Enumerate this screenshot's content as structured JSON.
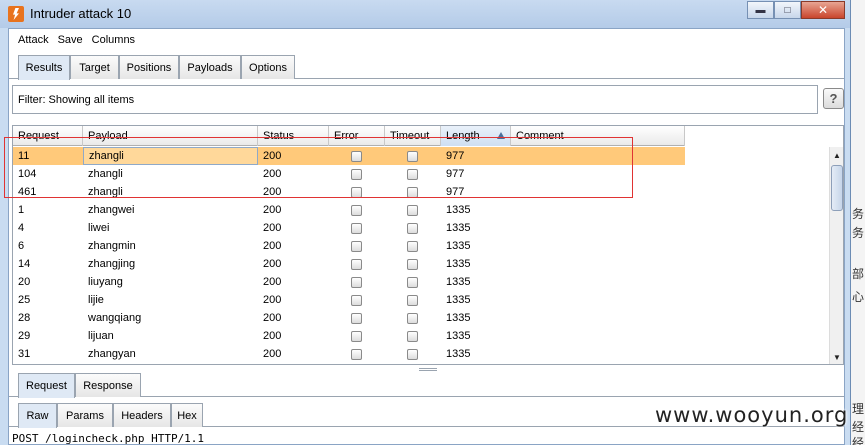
{
  "window": {
    "title": "Intruder attack 10"
  },
  "menu": [
    "Attack",
    "Save",
    "Columns"
  ],
  "tabs": [
    "Results",
    "Target",
    "Positions",
    "Payloads",
    "Options"
  ],
  "filter": {
    "text": "Filter:  Showing all items",
    "help_label": "?"
  },
  "table": {
    "columns": [
      "Request",
      "Payload",
      "Status",
      "Error",
      "Timeout",
      "Length",
      "Comment"
    ],
    "rows": [
      {
        "request": "11",
        "payload": "zhangli",
        "status": "200",
        "length": "977"
      },
      {
        "request": "104",
        "payload": "zhangli",
        "status": "200",
        "length": "977"
      },
      {
        "request": "461",
        "payload": "zhangli",
        "status": "200",
        "length": "977"
      },
      {
        "request": "1",
        "payload": "zhangwei",
        "status": "200",
        "length": "1335"
      },
      {
        "request": "4",
        "payload": "liwei",
        "status": "200",
        "length": "1335"
      },
      {
        "request": "6",
        "payload": "zhangmin",
        "status": "200",
        "length": "1335"
      },
      {
        "request": "14",
        "payload": "zhangjing",
        "status": "200",
        "length": "1335"
      },
      {
        "request": "20",
        "payload": "liuyang",
        "status": "200",
        "length": "1335"
      },
      {
        "request": "25",
        "payload": "lijie",
        "status": "200",
        "length": "1335"
      },
      {
        "request": "28",
        "payload": "wangqiang",
        "status": "200",
        "length": "1335"
      },
      {
        "request": "29",
        "payload": "lijuan",
        "status": "200",
        "length": "1335"
      },
      {
        "request": "31",
        "payload": "zhangyan",
        "status": "200",
        "length": "1335"
      }
    ]
  },
  "detail_tabs": [
    "Request",
    "Response"
  ],
  "editor_tabs": [
    "Raw",
    "Params",
    "Headers",
    "Hex"
  ],
  "editor": {
    "first_line": "POST /logincheck.php HTTP/1.1"
  },
  "background_glyphs": [
    "务",
    "务",
    "部",
    "心",
    "理",
    "经",
    "经"
  ],
  "watermark": "www.wooyun.org",
  "colors": {
    "selected_row": "#ffc97a",
    "annotation_box": "#e03333",
    "active_tab": "#dfe9f5"
  }
}
